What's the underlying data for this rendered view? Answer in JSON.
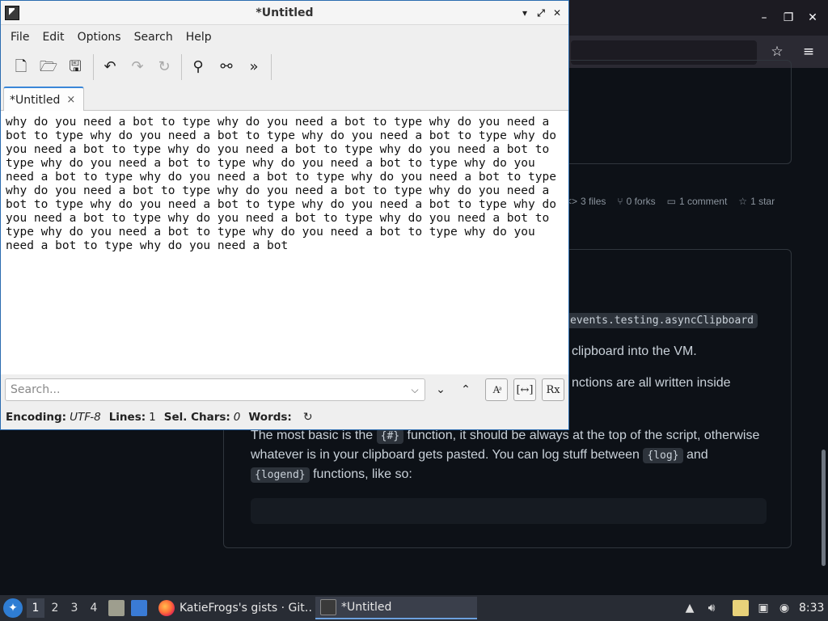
{
  "browser": {
    "window_controls": {
      "minimize": "–",
      "maximize": "❐",
      "close": "✕"
    },
    "bookmark_icon": "☆",
    "menu_icon": "≡",
    "gist_meta": {
      "files": "3 files",
      "forks": "0 forks",
      "comments": "1 comment",
      "stars": "1 star"
    },
    "content": {
      "code_inline_clipboard": "events.testing.asyncClipboard",
      "line_clipboard": "clipboard into the VM.",
      "line_functions": "nctions are all written inside",
      "para_part1": "The most basic is the ",
      "code_hash": "{#}",
      "para_part2": " function, it should be always at the top of the script, otherwise",
      "para_line2_part1": "whatever is in your clipboard gets pasted. You can log stuff between ",
      "code_log": "{log}",
      "para_line2_part2": " and",
      "code_logend": "{logend}",
      "para_line3_part2": " functions, like so:"
    }
  },
  "editor": {
    "title": "*Untitled",
    "window_buttons": {
      "minimize": "▾",
      "maximize": "⤢",
      "close": "✕"
    },
    "menu": [
      "File",
      "Edit",
      "Options",
      "Search",
      "Help"
    ],
    "toolbar_glyphs": {
      "new": "🗋",
      "open": "🗁",
      "save": "🖫",
      "undo": "↶",
      "redo": "↷",
      "reload": "↻",
      "find": "⚲",
      "replace": "⚯",
      "more": "»"
    },
    "tab": {
      "label": "*Untitled",
      "close": "×"
    },
    "text": "why do you need a bot to type why do you need a bot to type why do you need a bot to type why do you need a bot to type why do you need a bot to type why do you need a bot to type why do you need a bot to type why do you need a bot to type why do you need a bot to type why do you need a bot to type why do you need a bot to type why do you need a bot to type why do you need a bot to type why do you need a bot to type why do you need a bot to type why do you need a bot to type why do you need a bot to type why do you need a bot to type why do you need a bot to type why do you need a bot to type why do you need a bot to type why do you need a bot to type why do you need a bot to type why do you need a bot to type why do you need a bot",
    "search": {
      "placeholder": "Search...",
      "dropdown_glyph": "⌵",
      "next_glyph": "⌄",
      "prev_glyph": "⌃",
      "match_case_label": "Aͣ",
      "whole_word_label": "[↔]",
      "regex_label": "Rx"
    },
    "status": {
      "encoding_label": "Encoding:",
      "encoding_value": "UTF-8",
      "lines_label": "Lines:",
      "lines_value": "1",
      "sel_chars_label": "Sel. Chars:",
      "sel_chars_value": "0",
      "words_label": "Words:",
      "refresh_glyph": "↻"
    }
  },
  "taskbar": {
    "workspaces": [
      "1",
      "2",
      "3",
      "4"
    ],
    "active_workspace": "1",
    "tasks": [
      {
        "label": "KatieFrogs's gists · Git…",
        "icon": "firefox-icon"
      },
      {
        "label": "*Untitled",
        "icon": "featherpad-icon"
      }
    ],
    "clock": "8:33"
  },
  "colors": {
    "browser_bg": "#0d1117",
    "editor_bg": "#efefef",
    "taskbar_bg": "#282c34",
    "accent": "#3a87d8"
  }
}
